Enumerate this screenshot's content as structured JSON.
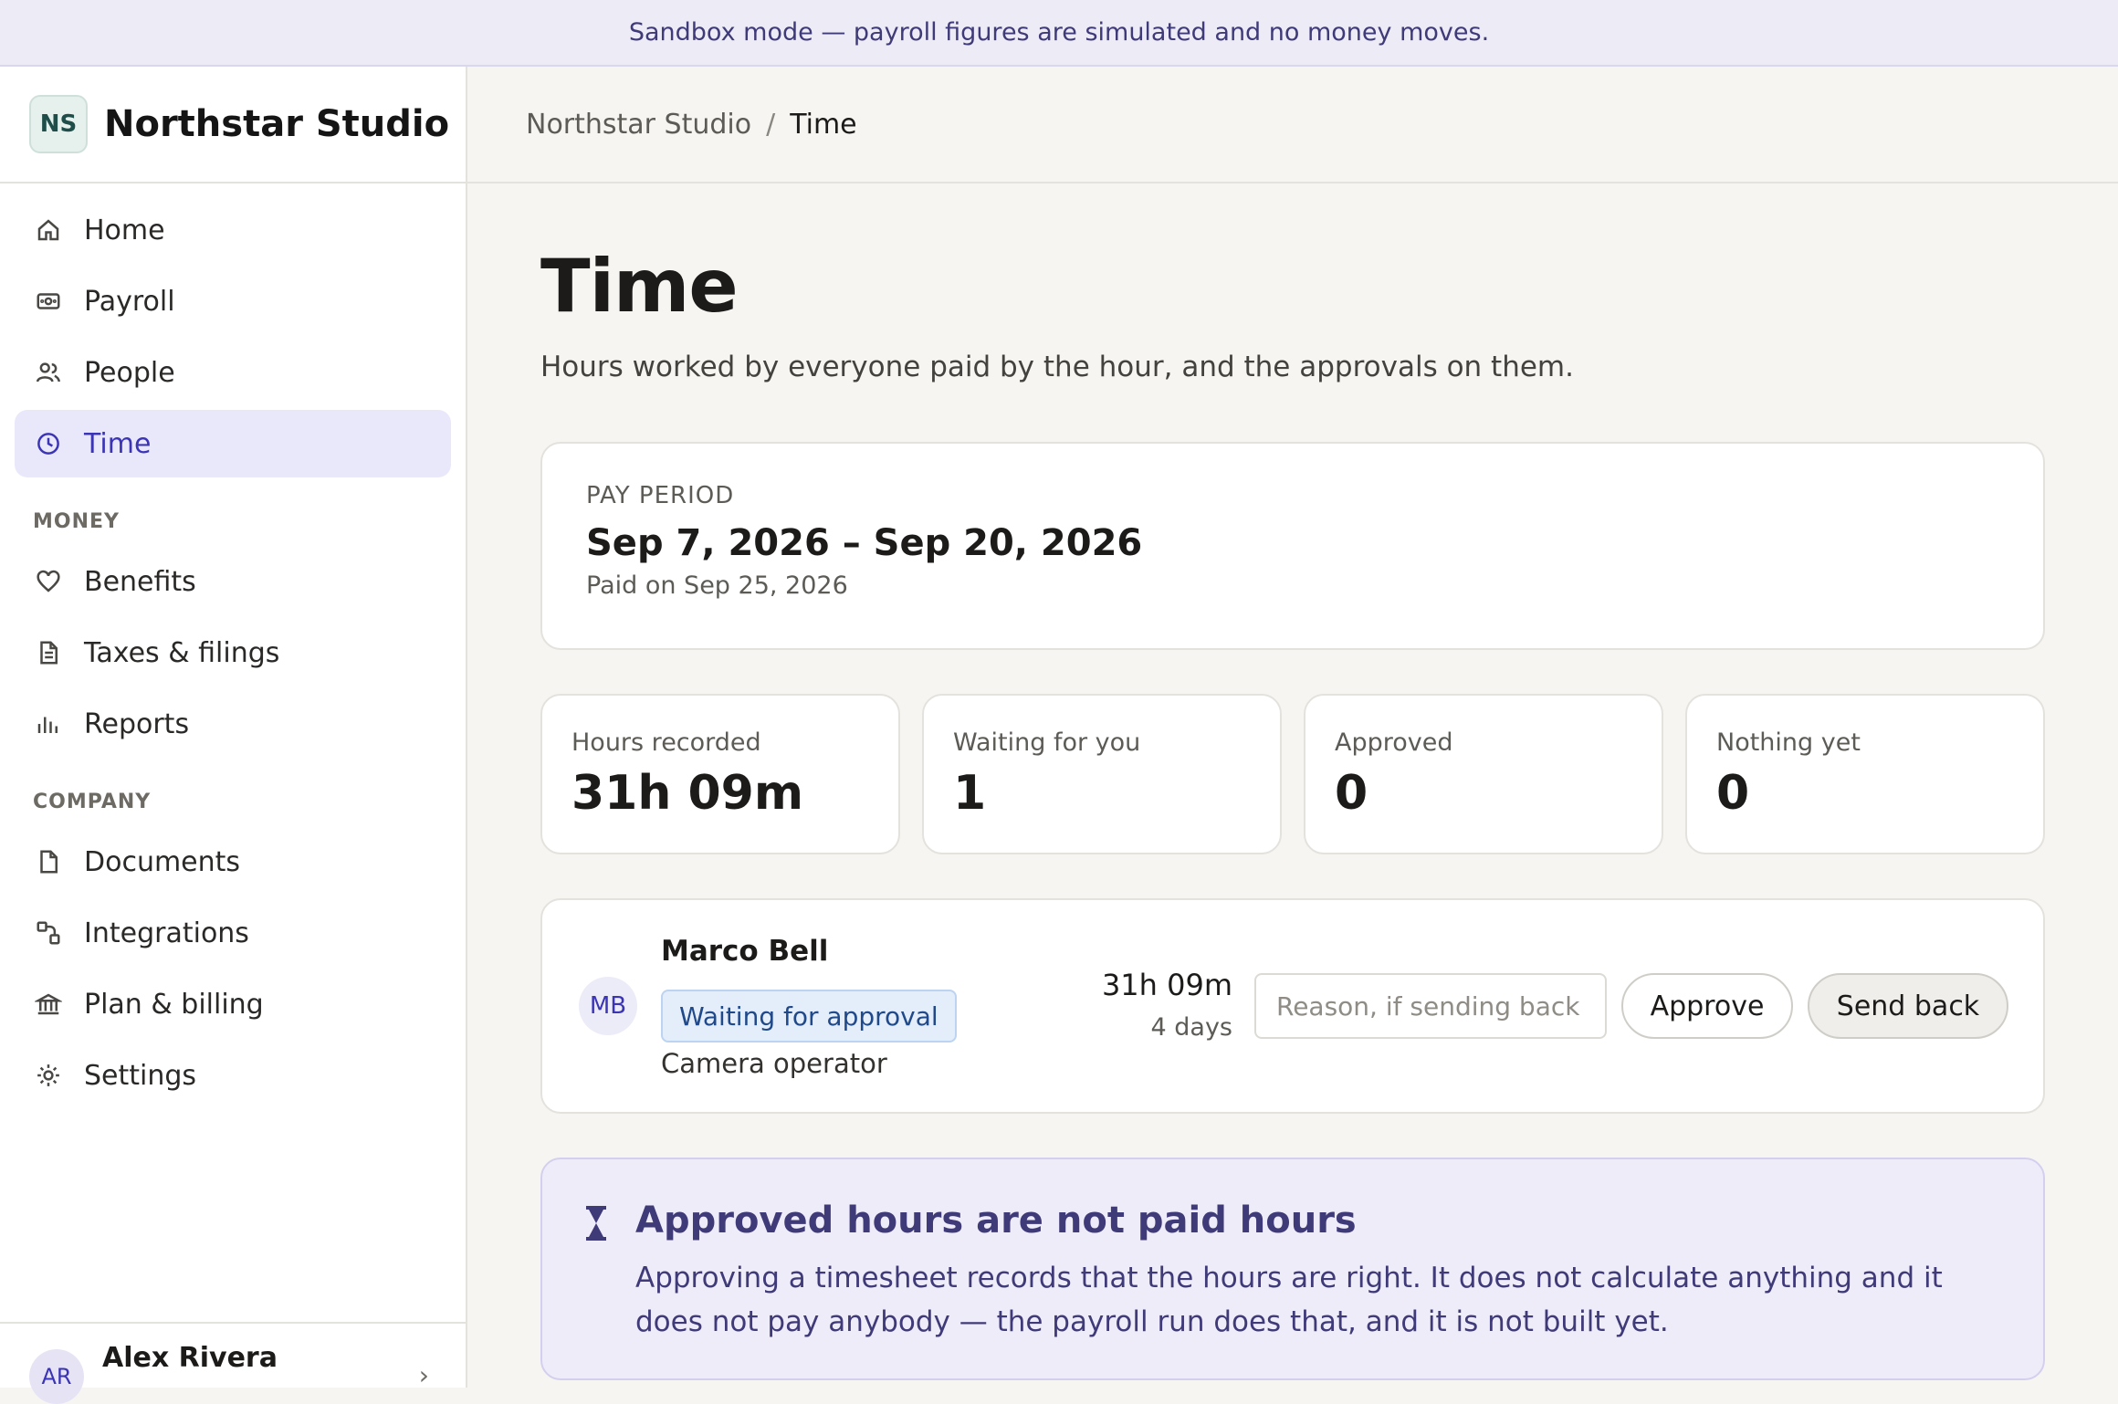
{
  "banner": {
    "text": "Sandbox mode — payroll figures are simulated and no money moves."
  },
  "brand": {
    "initials": "NS",
    "name": "Northstar Studio"
  },
  "sidebar": {
    "primary": [
      {
        "label": "Home",
        "icon": "home-icon"
      },
      {
        "label": "Payroll",
        "icon": "payroll-icon"
      },
      {
        "label": "People",
        "icon": "people-icon"
      },
      {
        "label": "Time",
        "icon": "clock-icon",
        "active": true
      }
    ],
    "money_label": "MONEY",
    "money": [
      {
        "label": "Benefits",
        "icon": "heart-icon"
      },
      {
        "label": "Taxes & filings",
        "icon": "document-icon"
      },
      {
        "label": "Reports",
        "icon": "bar-chart-icon"
      }
    ],
    "company_label": "COMPANY",
    "company": [
      {
        "label": "Documents",
        "icon": "file-icon"
      },
      {
        "label": "Integrations",
        "icon": "integrations-icon"
      },
      {
        "label": "Plan & billing",
        "icon": "bank-icon"
      },
      {
        "label": "Settings",
        "icon": "gear-icon"
      }
    ],
    "user": {
      "initials": "AR",
      "name": "Alex Rivera"
    }
  },
  "breadcrumb": {
    "parent": "Northstar Studio",
    "separator": "/",
    "current": "Time"
  },
  "page": {
    "title": "Time",
    "subtitle": "Hours worked by everyone paid by the hour, and the approvals on them."
  },
  "pay_period": {
    "label": "PAY PERIOD",
    "range": "Sep 7, 2026 – Sep 20, 2026",
    "paid_on": "Paid on Sep 25, 2026"
  },
  "stats": [
    {
      "label": "Hours recorded",
      "value": "31h 09m"
    },
    {
      "label": "Waiting for you",
      "value": "1"
    },
    {
      "label": "Approved",
      "value": "0"
    },
    {
      "label": "Nothing yet",
      "value": "0"
    }
  ],
  "entry": {
    "initials": "MB",
    "name": "Marco Bell",
    "status": "Waiting for approval",
    "role": "Camera operator",
    "hours": "31h 09m",
    "days": "4 days",
    "reason_placeholder": "Reason, if sending back",
    "reason_value": "",
    "approve_label": "Approve",
    "send_back_label": "Send back"
  },
  "note": {
    "icon": "hourglass-icon",
    "title": "Approved hours are not paid hours",
    "body": "Approving a timesheet records that the hours are right. It does not calculate anything and it does not pay anybody — the payroll run does that, and it is not built yet."
  },
  "colors": {
    "accent": "#3b35b5",
    "active_nav_bg": "#e9e8fb",
    "banner_bg": "#ecebf6",
    "note_bg": "#efecfa",
    "badge_bg": "#e4eefb"
  }
}
